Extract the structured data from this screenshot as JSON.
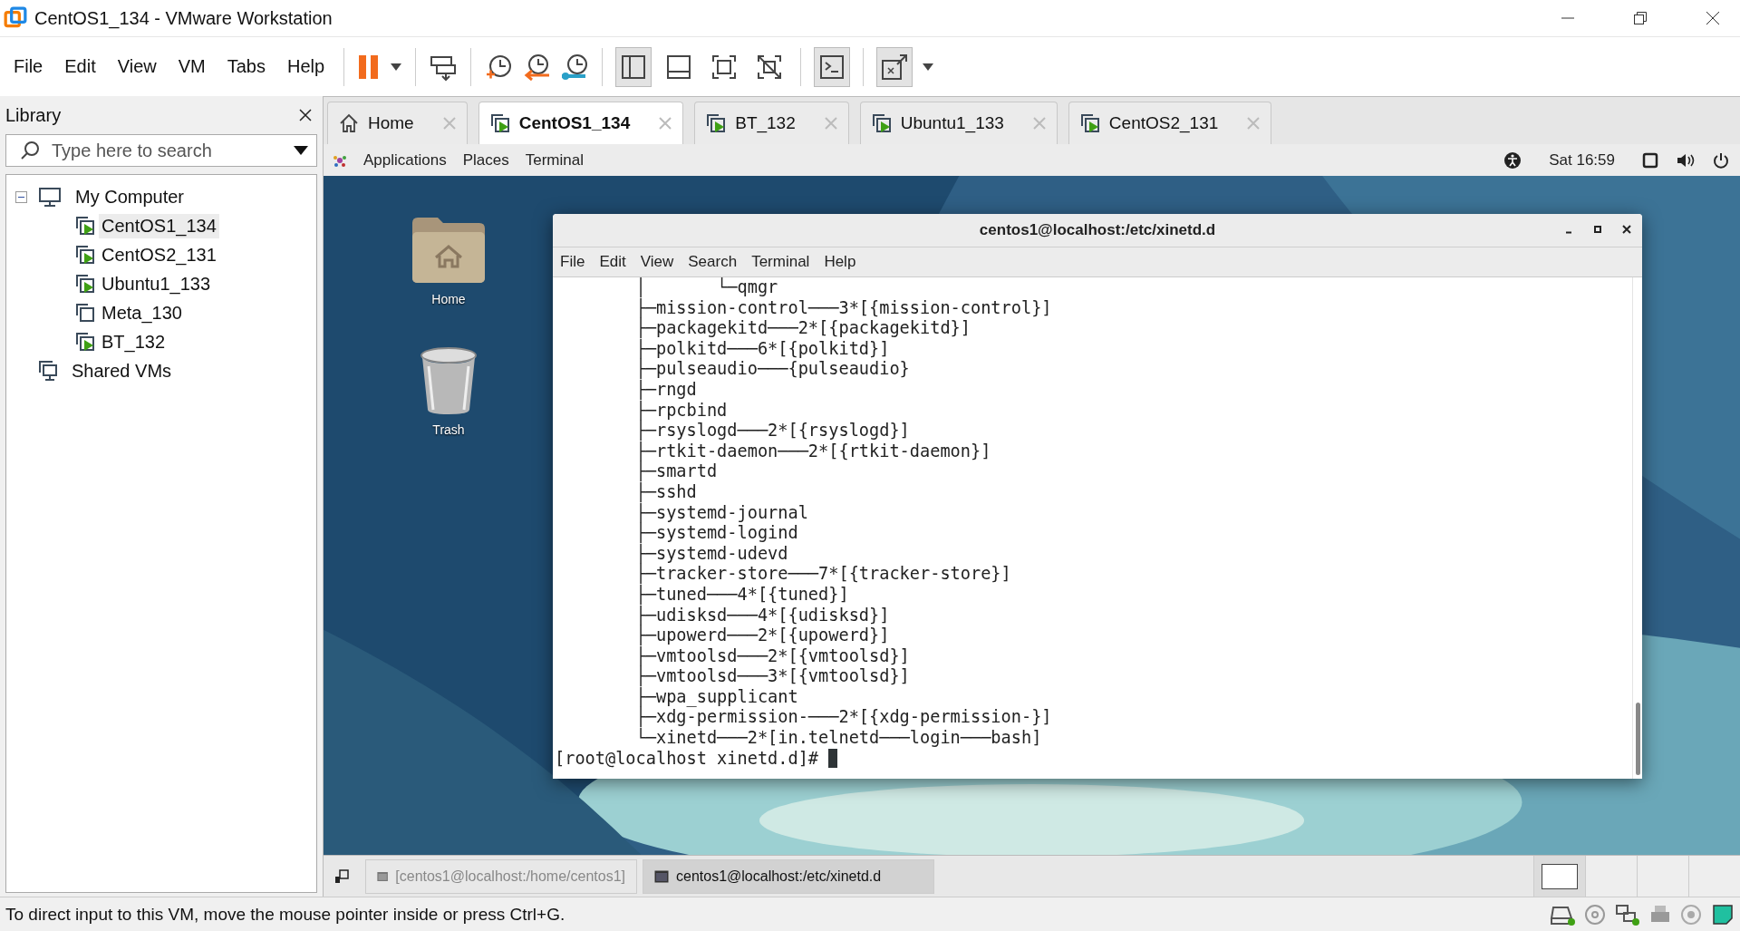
{
  "window": {
    "title": "CentOS1_134 - VMware Workstation"
  },
  "menu": [
    "File",
    "Edit",
    "View",
    "VM",
    "Tabs",
    "Help"
  ],
  "library": {
    "title": "Library",
    "search": {
      "placeholder": "Type here to search"
    },
    "tree": [
      {
        "label": "My Computer",
        "kind": "computer",
        "expanded": true,
        "children": [
          {
            "label": "CentOS1_134",
            "selected": true,
            "running": true
          },
          {
            "label": "CentOS2_131",
            "selected": false,
            "running": true
          },
          {
            "label": "Ubuntu1_133",
            "selected": false,
            "running": true
          },
          {
            "label": "Meta_130",
            "selected": false,
            "running": false
          },
          {
            "label": "BT_132",
            "selected": false,
            "running": true
          }
        ]
      },
      {
        "label": "Shared VMs",
        "kind": "shared"
      }
    ]
  },
  "tabs": [
    {
      "label": "Home",
      "kind": "home",
      "selected": false
    },
    {
      "label": "CentOS1_134",
      "kind": "vm",
      "selected": true
    },
    {
      "label": "BT_132",
      "kind": "vm",
      "selected": false
    },
    {
      "label": "Ubuntu1_133",
      "kind": "vm",
      "selected": false
    },
    {
      "label": "CentOS2_131",
      "kind": "vm",
      "selected": false
    }
  ],
  "guest_topbar": {
    "menus": [
      "Applications",
      "Places",
      "Terminal"
    ],
    "clock": "Sat 16:59"
  },
  "desktop_icons": [
    {
      "label": "Home",
      "kind": "folder"
    },
    {
      "label": "Trash",
      "kind": "trash"
    }
  ],
  "terminal": {
    "title": "centos1@localhost:/etc/xinetd.d",
    "menu": [
      "File",
      "Edit",
      "View",
      "Search",
      "Terminal",
      "Help"
    ],
    "lines": [
      "        │       └─qmgr",
      "        ├─mission-control───3*[{mission-control}]",
      "        ├─packagekitd───2*[{packagekitd}]",
      "        ├─polkitd───6*[{polkitd}]",
      "        ├─pulseaudio───{pulseaudio}",
      "        ├─rngd",
      "        ├─rpcbind",
      "        ├─rsyslogd───2*[{rsyslogd}]",
      "        ├─rtkit-daemon───2*[{rtkit-daemon}]",
      "        ├─smartd",
      "        ├─sshd",
      "        ├─systemd-journal",
      "        ├─systemd-logind",
      "        ├─systemd-udevd",
      "        ├─tracker-store───7*[{tracker-store}]",
      "        ├─tuned───4*[{tuned}]",
      "        ├─udisksd───4*[{udisksd}]",
      "        ├─upowerd───2*[{upowerd}]",
      "        ├─vmtoolsd───2*[{vmtoolsd}]",
      "        ├─vmtoolsd───3*[{vmtoolsd}]",
      "        ├─wpa_supplicant",
      "        ├─xdg-permission-───2*[{xdg-permission-}]",
      "        └─xinetd───2*[in.telnetd───login───bash]"
    ],
    "prompt": "[root@localhost xinetd.d]# "
  },
  "guest_taskbar": {
    "items": [
      {
        "label": "[centos1@localhost:/home/centos1]",
        "selected": false
      },
      {
        "label": "centos1@localhost:/etc/xinetd.d",
        "selected": true
      }
    ],
    "workspaces": [
      {
        "selected": true
      },
      {
        "selected": false
      },
      {
        "selected": false
      },
      {
        "selected": false
      }
    ]
  },
  "status_bar": {
    "message": "To direct input to this VM, move the mouse pointer inside or press Ctrl+G."
  }
}
